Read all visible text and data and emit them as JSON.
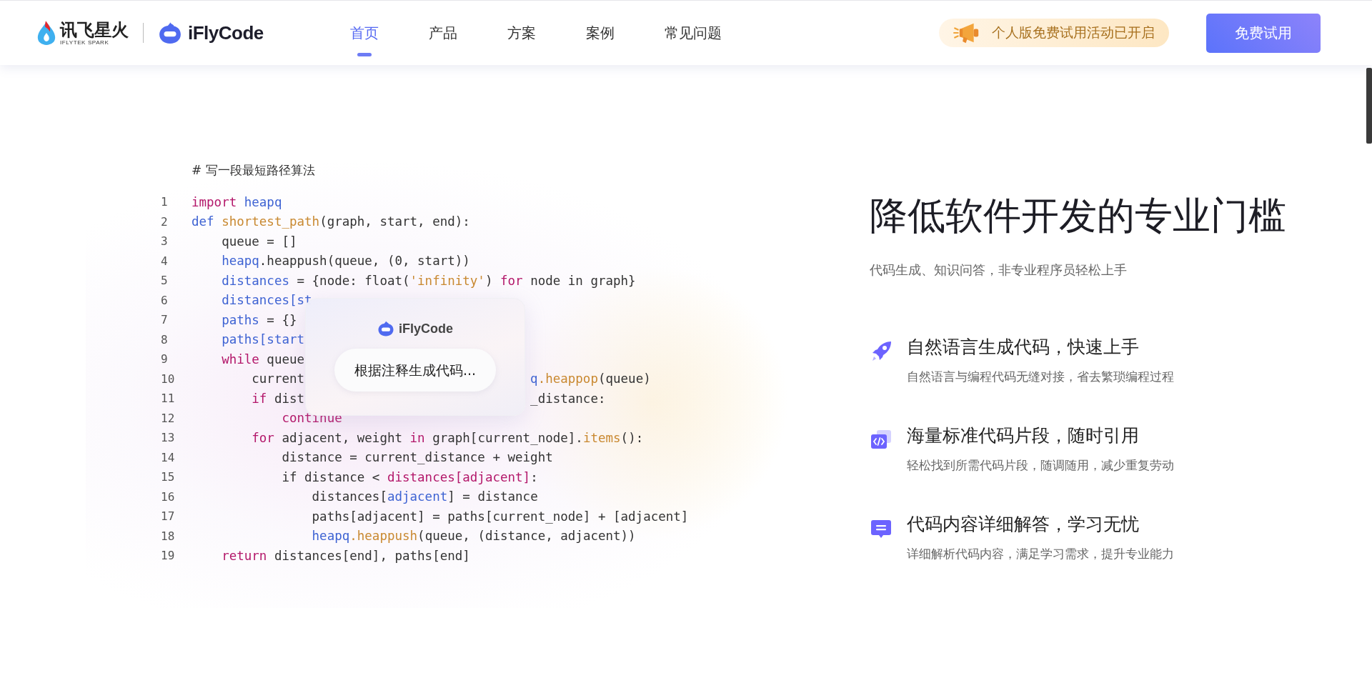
{
  "header": {
    "brand": {
      "name": "讯飞星火",
      "tagline": "IFLYTEK SPARK"
    },
    "product": {
      "name": "iFlyCode"
    },
    "nav": [
      {
        "label": "首页",
        "selected": true
      },
      {
        "label": "产品",
        "selected": false
      },
      {
        "label": "方案",
        "selected": false
      },
      {
        "label": "案例",
        "selected": false
      },
      {
        "label": "常见问题",
        "selected": false
      }
    ],
    "promo": {
      "text": "个人版免费试用活动已开启"
    },
    "cta": {
      "label": "免费试用"
    }
  },
  "demo": {
    "comment": "# 写一段最短路径算法",
    "lines": [
      {
        "number": "1",
        "tokens": [
          {
            "kind": "keyword",
            "t": "import"
          },
          {
            "kind": "name",
            "t": " heapq"
          }
        ]
      },
      {
        "number": "2",
        "tokens": [
          {
            "kind": "name",
            "t": "def"
          },
          {
            "kind": "call",
            "t": " shortest_path"
          },
          {
            "kind": "text",
            "t": "(graph, start, end):"
          }
        ]
      },
      {
        "number": "3",
        "tokens": [
          {
            "kind": "text",
            "t": "    queue = []"
          }
        ]
      },
      {
        "number": "4",
        "tokens": [
          {
            "kind": "name",
            "t": "    heapq"
          },
          {
            "kind": "text",
            "t": ".heappush(queue, (0, start))"
          }
        ]
      },
      {
        "number": "5",
        "tokens": [
          {
            "kind": "name",
            "t": "    distances"
          },
          {
            "kind": "text",
            "t": " = {node: float("
          },
          {
            "kind": "call",
            "t": "'infinity'"
          },
          {
            "kind": "text",
            "t": ") "
          },
          {
            "kind": "keyword",
            "t": "for"
          },
          {
            "kind": "text",
            "t": " node in graph}"
          }
        ]
      },
      {
        "number": "6",
        "tokens": [
          {
            "kind": "name",
            "t": "    distances[st"
          }
        ]
      },
      {
        "number": "7",
        "tokens": [
          {
            "kind": "name",
            "t": "    paths"
          },
          {
            "kind": "text",
            "t": " = {}"
          }
        ]
      },
      {
        "number": "8",
        "tokens": [
          {
            "kind": "name",
            "t": "    paths[start"
          }
        ]
      },
      {
        "number": "9",
        "tokens": [
          {
            "kind": "keyword",
            "t": "    while"
          },
          {
            "kind": "text",
            "t": " queue"
          }
        ]
      },
      {
        "number": "10",
        "tokens": [
          {
            "kind": "text",
            "t": "        current"
          }
        ],
        "after": [
          {
            "kind": "name",
            "t": "q"
          },
          {
            "kind": "call",
            "t": ".heappop"
          },
          {
            "kind": "text",
            "t": "(queue)"
          }
        ]
      },
      {
        "number": "11",
        "tokens": [
          {
            "kind": "keyword",
            "t": "        if"
          },
          {
            "kind": "text",
            "t": " dist"
          }
        ],
        "after": [
          {
            "kind": "text",
            "t": "_distance:"
          }
        ]
      },
      {
        "number": "12",
        "tokens": [
          {
            "kind": "keyword",
            "t": "            continue"
          }
        ]
      },
      {
        "number": "13",
        "tokens": [
          {
            "kind": "keyword",
            "t": "        for"
          },
          {
            "kind": "text",
            "t": " adjacent, weight "
          },
          {
            "kind": "keyword",
            "t": "in"
          },
          {
            "kind": "text",
            "t": " graph[current_node]."
          },
          {
            "kind": "call",
            "t": "items"
          },
          {
            "kind": "text",
            "t": "():"
          }
        ]
      },
      {
        "number": "14",
        "tokens": [
          {
            "kind": "text",
            "t": "            distance = current_distance + weight"
          }
        ]
      },
      {
        "number": "15",
        "tokens": [
          {
            "kind": "text",
            "t": "            if distance < "
          },
          {
            "kind": "keyword",
            "t": "distances[adjacent]"
          },
          {
            "kind": "text",
            "t": ":"
          }
        ]
      },
      {
        "number": "16",
        "tokens": [
          {
            "kind": "text",
            "t": "                distances["
          },
          {
            "kind": "name",
            "t": "adjacent"
          },
          {
            "kind": "text",
            "t": "] = distance"
          }
        ]
      },
      {
        "number": "17",
        "tokens": [
          {
            "kind": "text",
            "t": "                paths[adjacent] = paths[current_node] + [adjacent]"
          }
        ]
      },
      {
        "number": "18",
        "tokens": [
          {
            "kind": "name",
            "t": "                heapq"
          },
          {
            "kind": "call",
            "t": ".heappush"
          },
          {
            "kind": "text",
            "t": "(queue, (distance, adjacent))"
          }
        ]
      },
      {
        "number": "19",
        "tokens": [
          {
            "kind": "keyword",
            "t": "    return"
          },
          {
            "kind": "text",
            "t": " distances[end], paths[end]"
          }
        ]
      }
    ],
    "popup": {
      "brand": "iFlyCode",
      "status": "根据注释生成代码..."
    }
  },
  "intro": {
    "title": "降低软件开发的专业门槛",
    "subtitle": "代码生成、知识问答，非专业程序员轻松上手",
    "features": [
      {
        "kind": "rocket",
        "title": "自然语言生成代码，快速上手",
        "description": "自然语言与编程代码无缝对接，省去繁琐编程过程"
      },
      {
        "kind": "snippet",
        "title": "海量标准代码片段，随时引用",
        "description": "轻松找到所需代码片段，随调随用，减少重复劳动"
      },
      {
        "kind": "chat",
        "title": "代码内容详细解答，学习无忧",
        "description": "详细解析代码内容，满足学习需求，提升专业能力"
      }
    ]
  }
}
